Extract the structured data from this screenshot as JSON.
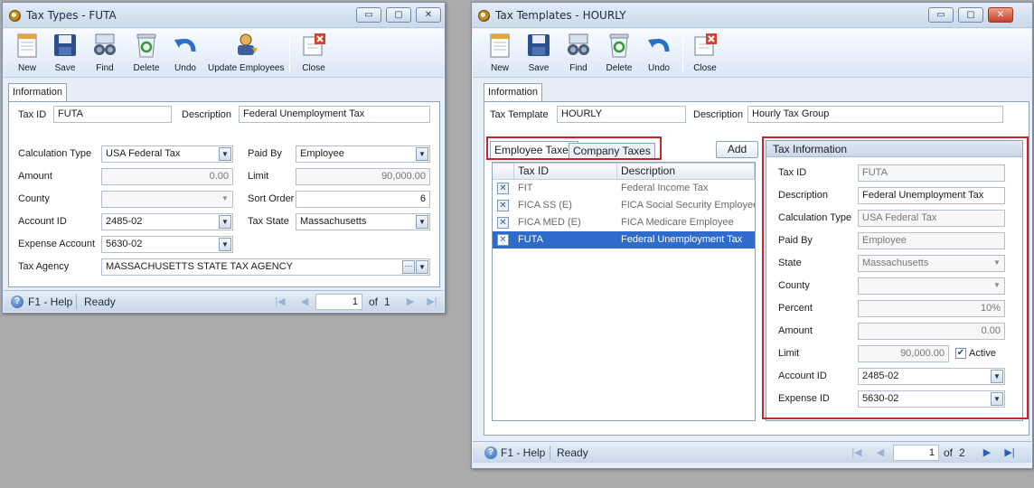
{
  "colors": {
    "desktop": "#ababab",
    "selection": "#2e6bcc",
    "highlight_box": "#c1272d"
  },
  "window1": {
    "title": "Tax Types - FUTA",
    "toolbar": [
      "New",
      "Save",
      "Find",
      "Delete",
      "Undo",
      "Update Employees",
      "Close"
    ],
    "tab": "Information",
    "labels": {
      "tax_id": "Tax ID",
      "description": "Description",
      "calculation_type": "Calculation Type",
      "paid_by": "Paid By",
      "amount": "Amount",
      "limit": "Limit",
      "county": "County",
      "sort_order": "Sort Order",
      "account_id": "Account ID",
      "tax_state": "Tax State",
      "expense_account": "Expense Account",
      "tax_agency": "Tax Agency"
    },
    "values": {
      "tax_id": "FUTA",
      "description": "Federal Unemployment Tax",
      "calculation_type": "USA Federal Tax",
      "paid_by": "Employee",
      "amount": "0.00",
      "limit": "90,000.00",
      "county": "",
      "sort_order": "6",
      "account_id": "2485-02",
      "tax_state": "Massachusetts",
      "expense_account": "5630-02",
      "tax_agency": "MASSACHUSETTS STATE TAX AGENCY"
    },
    "status": {
      "help": "F1 - Help",
      "state": "Ready",
      "page": "1",
      "of_label": "of",
      "total": "1"
    }
  },
  "window2": {
    "title": "Tax Templates - HOURLY",
    "toolbar": [
      "New",
      "Save",
      "Find",
      "Delete",
      "Undo",
      "Close"
    ],
    "tab": "Information",
    "labels": {
      "tax_template": "Tax Template",
      "description": "Description"
    },
    "values": {
      "tax_template": "HOURLY",
      "description": "Hourly Tax Group"
    },
    "subtabs": [
      "Employee Taxes",
      "Company Taxes"
    ],
    "add_button": "Add",
    "grid": {
      "columns": [
        "Tax ID",
        "Description"
      ],
      "rows": [
        {
          "tax_id": "FIT",
          "description": "Federal Income Tax",
          "selected": false
        },
        {
          "tax_id": "FICA SS (E)",
          "description": "FICA Social Security Employee",
          "selected": false
        },
        {
          "tax_id": "FICA MED (E)",
          "description": "FICA Medicare Employee",
          "selected": false
        },
        {
          "tax_id": "FUTA",
          "description": "Federal Unemployment Tax",
          "selected": true
        }
      ]
    },
    "tax_info": {
      "header": "Tax Information",
      "labels": {
        "tax_id": "Tax ID",
        "description": "Description",
        "calculation_type": "Calculation Type",
        "paid_by": "Paid By",
        "state": "State",
        "county": "County",
        "percent": "Percent",
        "amount": "Amount",
        "limit": "Limit",
        "account_id": "Account ID",
        "expense_id": "Expense ID"
      },
      "values": {
        "tax_id": "FUTA",
        "description": "Federal Unemployment Tax",
        "calculation_type": "USA Federal Tax",
        "paid_by": "Employee",
        "state": "Massachusetts",
        "county": "",
        "percent": "10%",
        "amount": "0.00",
        "limit": "90,000.00",
        "active_label": "Active",
        "active": true,
        "account_id": "2485-02",
        "expense_id": "5630-02"
      }
    },
    "status": {
      "help": "F1 - Help",
      "state": "Ready",
      "page": "1",
      "of_label": "of",
      "total": "2"
    }
  }
}
